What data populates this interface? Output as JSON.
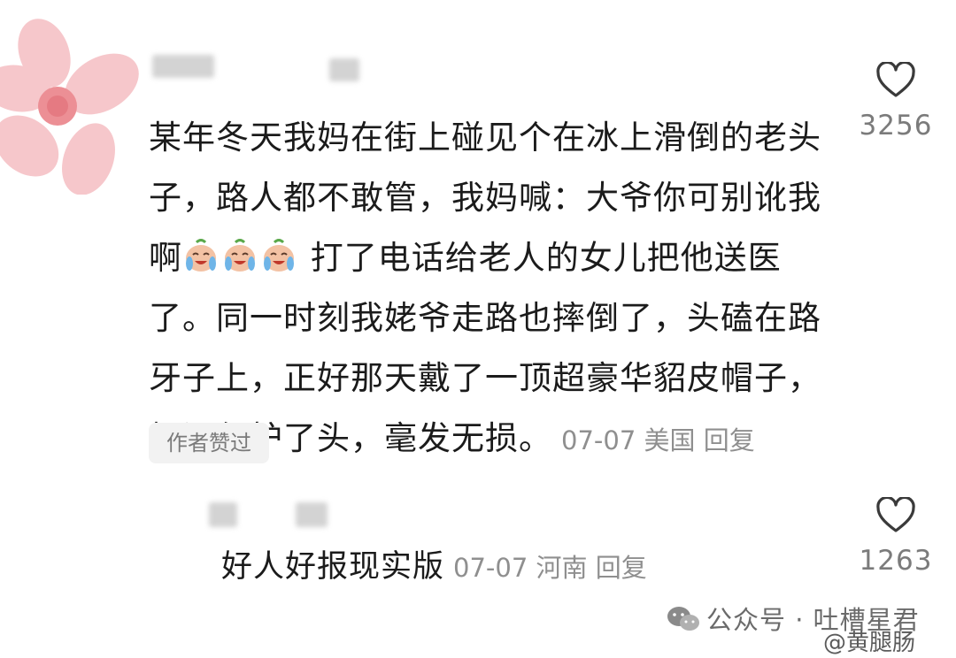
{
  "comments": [
    {
      "lines": [
        "某年冬天我妈在街上碰见个在冰上滑倒的老头",
        "子，路人都不敢管，我妈喊：大爷你可别讹我",
        "啊",
        "打了电话给老人的女儿把他送医",
        "了。同一时刻我姥爷走路也摔倒了，头磕在路",
        "牙子上，正好那天戴了一顶超豪华貂皮帽子，",
        "帽沿保护了头，毫发无损。"
      ],
      "emojis": [
        "crying-laughing-emoji",
        "crying-laughing-emoji",
        "crying-laughing-emoji"
      ],
      "date": "07-07",
      "location": "美国",
      "reply_label": "回复",
      "author_liked": "作者赞过",
      "likes": "3256"
    },
    {
      "text": "好人好报现实版",
      "date": "07-07",
      "location": "河南",
      "reply_label": "回复",
      "likes": "1263"
    }
  ],
  "watermark": {
    "channel": "公众号 · 吐槽星君",
    "weibo": "@黄腿肠"
  },
  "icons": {
    "like": "heart-outline-icon",
    "wechat": "wechat-icon"
  },
  "colors": {
    "text": "#1b1b1b",
    "meta": "#8f8f8f",
    "badge_bg": "#f2f2f2",
    "avatar_petal": "#f4b6bb"
  }
}
